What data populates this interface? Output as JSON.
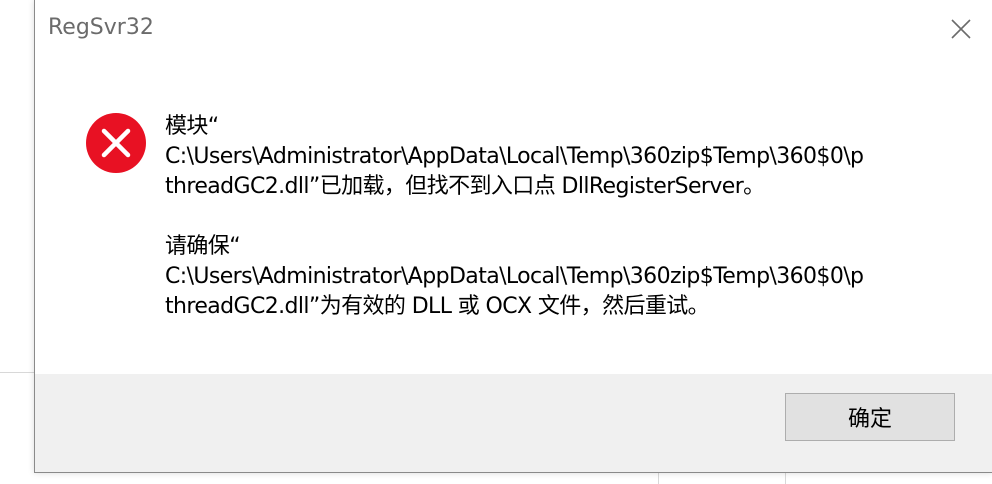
{
  "dialog": {
    "title": "RegSvr32",
    "close_icon": "close-icon",
    "error_icon": "error-icon",
    "error_color": "#e81123",
    "message_lines": [
      "模块“",
      "C:\\Users\\Administrator\\AppData\\Local\\Temp\\360zip$Temp\\360$0\\p",
      "threadGC2.dll”已加载，但找不到入口点 DllRegisterServer。",
      "",
      "请确保“",
      "C:\\Users\\Administrator\\AppData\\Local\\Temp\\360zip$Temp\\360$0\\p",
      "threadGC2.dll”为有效的 DLL 或 OCX 文件，然后重试。"
    ],
    "ok_label": "确定"
  }
}
